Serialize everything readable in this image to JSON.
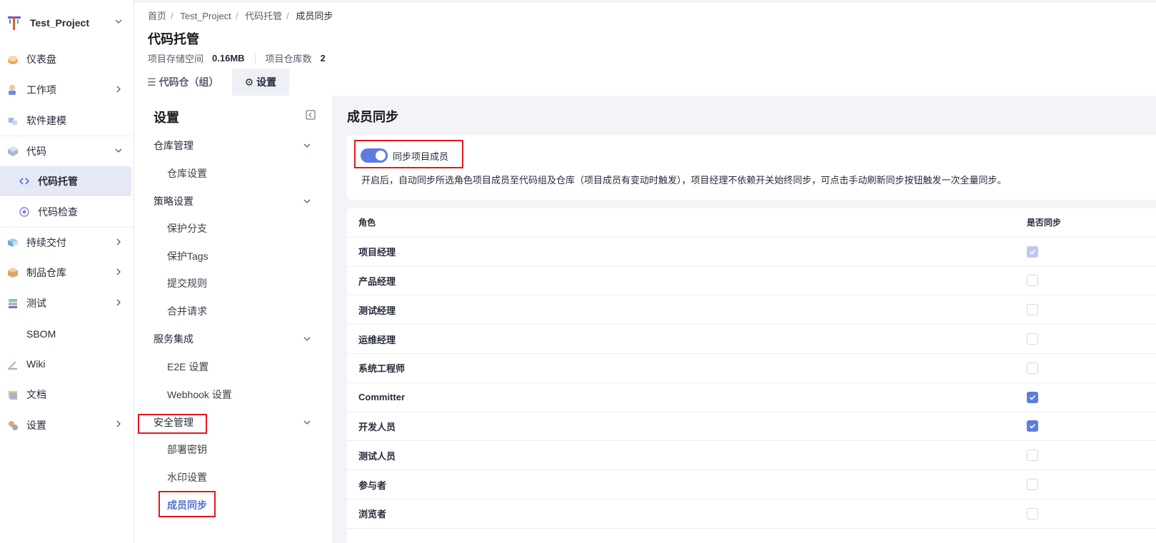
{
  "project": {
    "name": "Test_Project"
  },
  "nav": {
    "items": [
      {
        "label": "仪表盘",
        "icon": "dashboard-icon"
      },
      {
        "label": "工作项",
        "icon": "workitem-icon"
      },
      {
        "label": "软件建模",
        "icon": "modeling-icon"
      },
      {
        "label": "代码",
        "icon": "code-icon"
      },
      {
        "label": "代码托管",
        "icon": "code-hosting-icon"
      },
      {
        "label": "代码检查",
        "icon": "code-check-icon"
      },
      {
        "label": "持续交付",
        "icon": "delivery-icon"
      },
      {
        "label": "制品仓库",
        "icon": "artifact-icon"
      },
      {
        "label": "测试",
        "icon": "test-icon"
      },
      {
        "label": "SBOM",
        "icon": ""
      },
      {
        "label": "Wiki",
        "icon": "wiki-icon"
      },
      {
        "label": "文档",
        "icon": "docs-icon"
      },
      {
        "label": "设置",
        "icon": "settings-icon"
      }
    ]
  },
  "breadcrumb": [
    "首页",
    "Test_Project",
    "代码托管",
    "成员同步"
  ],
  "page": {
    "title": "代码托管",
    "storage_label": "项目存储空间",
    "storage_value": "0.16MB",
    "repo_count_label": "项目仓库数",
    "repo_count_value": "2"
  },
  "tabs": [
    {
      "label": "代码仓（组）",
      "icon": "list-icon"
    },
    {
      "label": "设置",
      "icon": "gear-icon"
    }
  ],
  "settings_menu": {
    "title": "设置",
    "groups": [
      {
        "label": "仓库管理",
        "items": [
          "仓库设置"
        ]
      },
      {
        "label": "策略设置",
        "items": [
          "保护分支",
          "保护Tags",
          "提交规则",
          "合并请求"
        ]
      },
      {
        "label": "服务集成",
        "items": [
          "E2E 设置",
          "Webhook 设置"
        ]
      },
      {
        "label": "安全管理",
        "items": [
          "部署密钥",
          "水印设置",
          "成员同步"
        ]
      }
    ]
  },
  "main": {
    "title": "成员同步",
    "toggle_label": "同步项目成员",
    "toggle_on": true,
    "description": "开启后，自动同步所选角色项目成员至代码组及仓库（项目成员有变动时触发），项目经理不依赖开关始终同步，可点击手动刷新同步按钮触发一次全量同步。",
    "table": {
      "headers": [
        "角色",
        "是否同步"
      ],
      "rows": [
        {
          "role": "项目经理",
          "checked": true,
          "disabled": true
        },
        {
          "role": "产品经理",
          "checked": false,
          "disabled": false
        },
        {
          "role": "测试经理",
          "checked": false,
          "disabled": false
        },
        {
          "role": "运维经理",
          "checked": false,
          "disabled": false
        },
        {
          "role": "系统工程师",
          "checked": false,
          "disabled": false
        },
        {
          "role": "Committer",
          "checked": true,
          "disabled": false
        },
        {
          "role": "开发人员",
          "checked": true,
          "disabled": false
        },
        {
          "role": "测试人员",
          "checked": false,
          "disabled": false
        },
        {
          "role": "参与者",
          "checked": false,
          "disabled": false
        },
        {
          "role": "浏览者",
          "checked": false,
          "disabled": false
        }
      ]
    }
  },
  "colors": {
    "accent": "#5e7ce0",
    "highlight": "#e5171b",
    "active_nav_bg": "#e5e8f6"
  }
}
